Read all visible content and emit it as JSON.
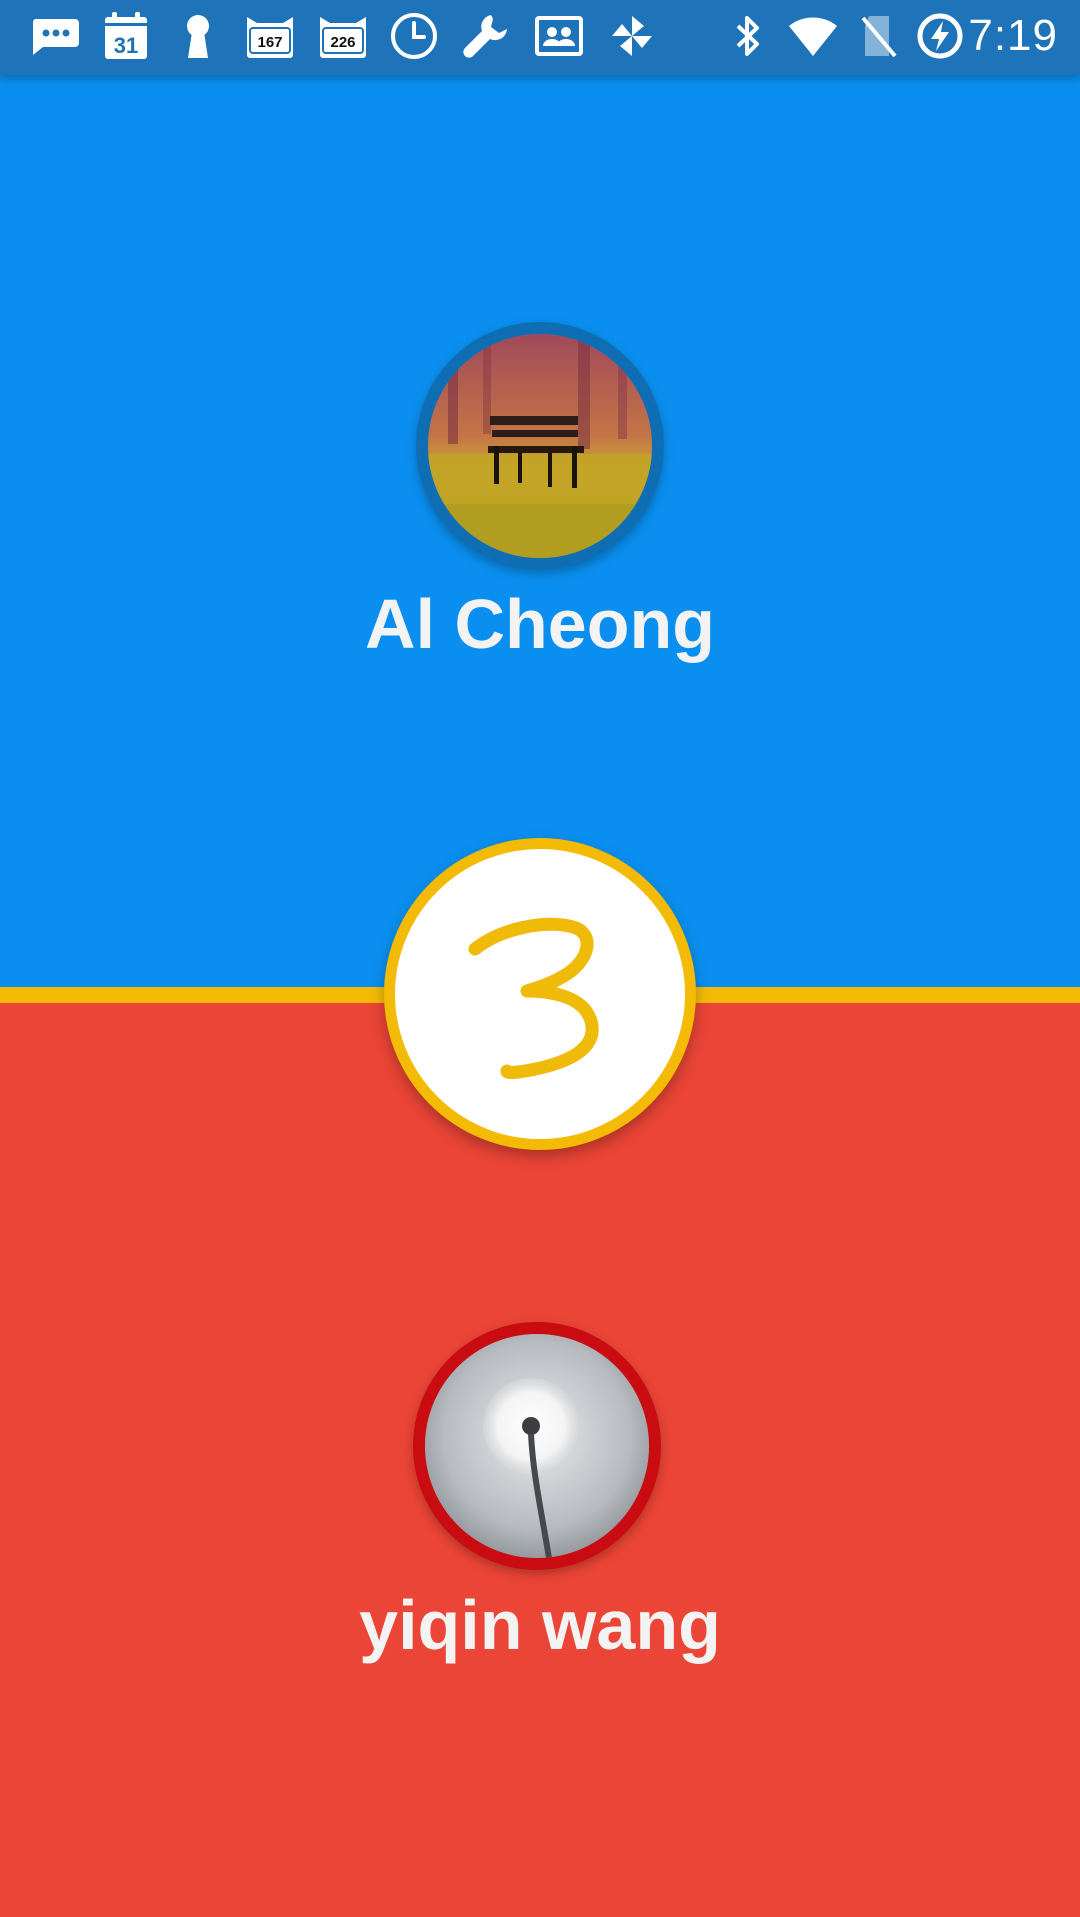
{
  "status_bar": {
    "time": "7:19",
    "notifications": [
      {
        "icon": "messaging-icon"
      },
      {
        "icon": "calendar-icon",
        "label": "31"
      },
      {
        "icon": "keyhole-icon"
      },
      {
        "icon": "game-badge-icon",
        "label": "167"
      },
      {
        "icon": "game-badge-icon",
        "label": "226"
      },
      {
        "icon": "clock-icon"
      },
      {
        "icon": "wrench-icon"
      },
      {
        "icon": "contacts-card-icon"
      },
      {
        "icon": "pinwheel-icon"
      }
    ],
    "system_icons": [
      "bluetooth-icon",
      "wifi-icon",
      "no-sim-icon",
      "battery-charging-icon"
    ]
  },
  "game": {
    "round": "3",
    "player_top": {
      "name": "Al Cheong",
      "color": "#0a8ff0",
      "ring_color": "#0f6db4",
      "avatar": "park-bench-photo"
    },
    "player_bottom": {
      "name": "yiqin wang",
      "color": "#ea4536",
      "ring_color": "#c80c11",
      "avatar": "dandelion-photo"
    },
    "accent_color": "#f3bb06"
  }
}
